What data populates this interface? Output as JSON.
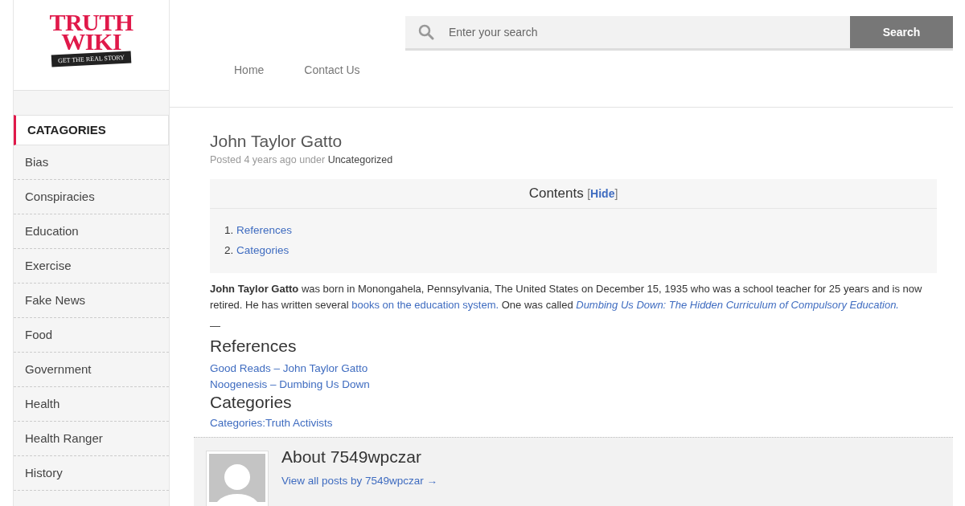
{
  "logo": {
    "title_lines": [
      "TRUTH",
      "WIKI"
    ],
    "tagline": "GET THE REAL STORY"
  },
  "search": {
    "placeholder": "Enter your search",
    "button": "Search"
  },
  "nav": [
    {
      "label": "Home"
    },
    {
      "label": "Contact Us"
    }
  ],
  "sidebar": {
    "heading": "CATAGORIES",
    "items": [
      {
        "label": "Bias"
      },
      {
        "label": "Conspiracies"
      },
      {
        "label": "Education"
      },
      {
        "label": "Exercise"
      },
      {
        "label": "Fake News"
      },
      {
        "label": "Food"
      },
      {
        "label": "Government"
      },
      {
        "label": "Health"
      },
      {
        "label": "Health Ranger"
      },
      {
        "label": "History"
      }
    ]
  },
  "post": {
    "title": "John Taylor Gatto",
    "meta_prefix": "Posted 4 years ago under",
    "category": "Uncategorized",
    "toc": {
      "title": "Contents",
      "toggle_open": "[",
      "toggle": "Hide",
      "toggle_close": "]",
      "items": [
        {
          "number": "1.",
          "label": "References"
        },
        {
          "number": "2.",
          "label": "Categories"
        }
      ]
    },
    "paragraph": [
      {
        "kind": "bold",
        "text": "John Taylor Gatto"
      },
      {
        "kind": "text",
        "text": " was born in Monongahela, Pennsylvania, The United States on December 15, 1935 who was a school teacher for 25 years and is now retired. He has written several "
      },
      {
        "kind": "link",
        "text": "books on the education system."
      },
      {
        "kind": "text",
        "text": " One was called "
      },
      {
        "kind": "italic_link",
        "text": "Dumbing Us Down: The Hidden Curriculum of Compulsory Education."
      }
    ],
    "dash": "—",
    "references_heading": "References",
    "references": [
      {
        "label": "Good Reads – John Taylor Gatto"
      },
      {
        "label": "Noogenesis – Dumbing Us Down"
      }
    ],
    "categories_heading": "Categories",
    "categories": [
      {
        "label": "Categories:Truth Activists"
      }
    ]
  },
  "author": {
    "title": "About 7549wpczar",
    "link": "View all posts by 7549wpczar →"
  }
}
